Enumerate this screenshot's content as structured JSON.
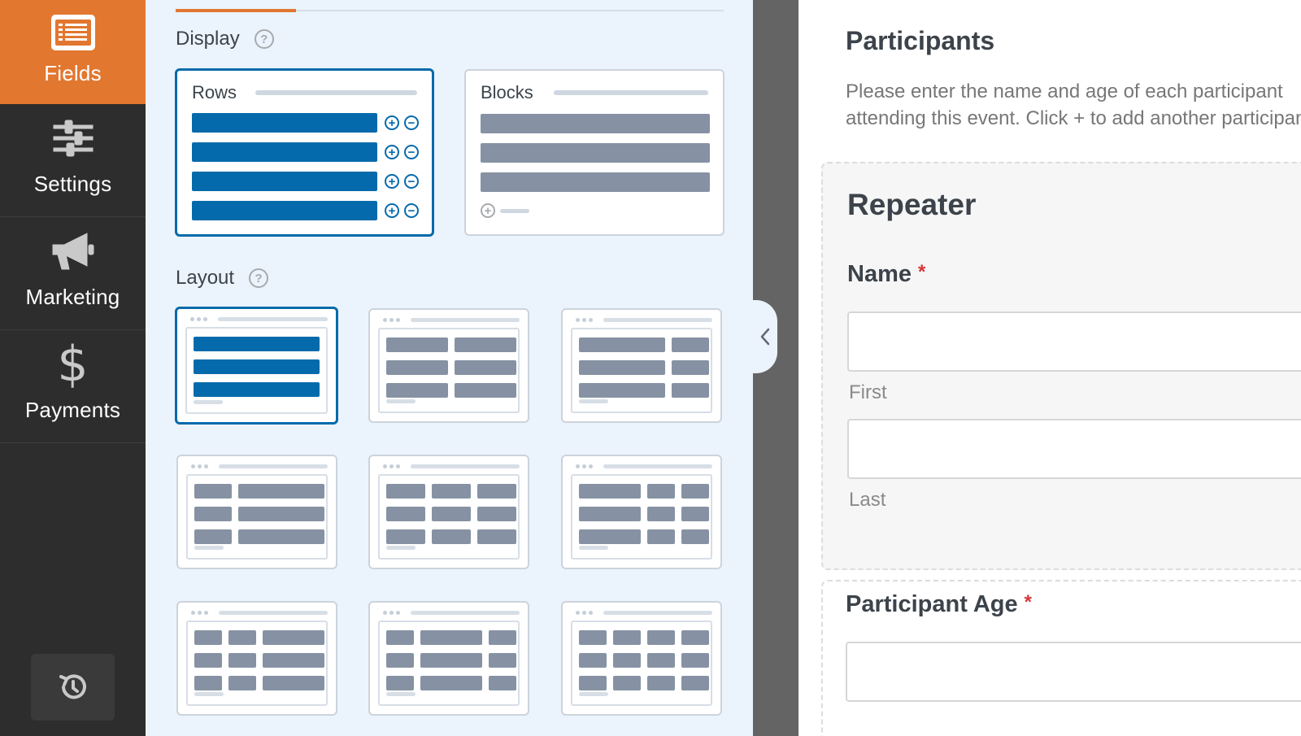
{
  "nav": {
    "fields": "Fields",
    "settings": "Settings",
    "marketing": "Marketing",
    "payments": "Payments"
  },
  "options": {
    "display_label": "Display",
    "display_help": "?",
    "display_choices": [
      {
        "label": "Rows",
        "selected": true
      },
      {
        "label": "Blocks",
        "selected": false
      }
    ],
    "layout_label": "Layout",
    "layout_help": "?",
    "layout_selected_index": 0
  },
  "preview": {
    "section_title": "Participants",
    "section_description": "Please enter the name and age of each participant attending this event. Click + to add another participant.",
    "repeater_title": "Repeater",
    "name_label": "Name",
    "required_mark": "*",
    "first_sublabel": "First",
    "last_sublabel": "Last",
    "age_label": "Participant Age"
  },
  "colors": {
    "accent": "#e27730",
    "selected_blue": "#056aab",
    "nav_bg": "#2d2d2d",
    "panel_bg": "#ebf3fc"
  }
}
